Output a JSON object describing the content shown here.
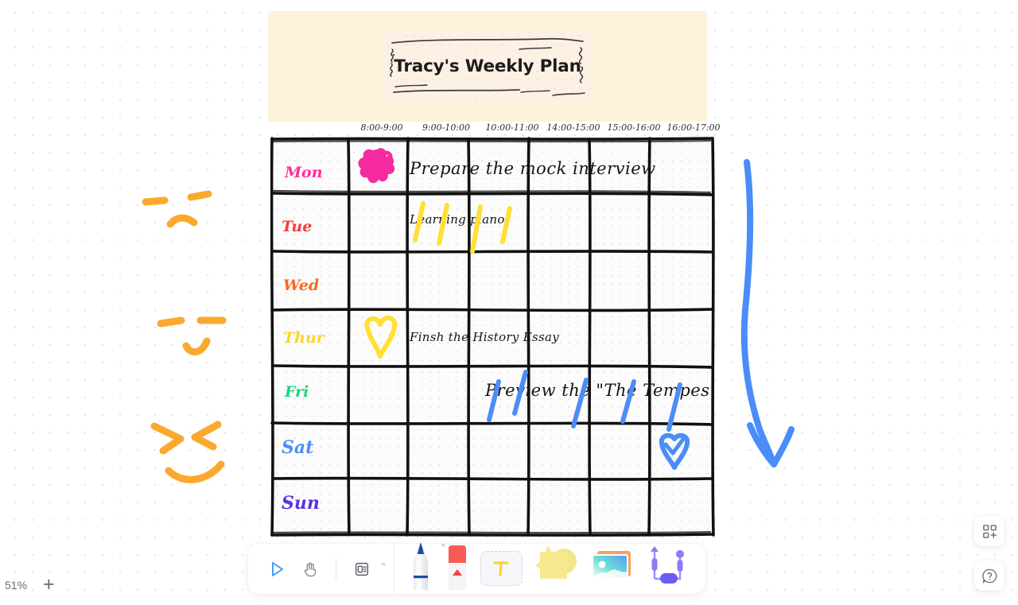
{
  "app": {
    "zoom_level": "51%",
    "zoom_in_label": "+"
  },
  "board": {
    "title": "Tracy's Weekly Plan",
    "time_slots": [
      "8:00-9:00",
      "9:00-10:00",
      "10:00-11:00",
      "14:00-15:00",
      "15:00-16:00",
      "16:00-17:00"
    ],
    "days": [
      {
        "label": "Mon",
        "color": "#ff2e9a"
      },
      {
        "label": "Tue",
        "color": "#f93a3a"
      },
      {
        "label": "Wed",
        "color": "#fa6a1e"
      },
      {
        "label": "Thur",
        "color": "#ffd429"
      },
      {
        "label": "Fri",
        "color": "#19d67f"
      },
      {
        "label": "Sat",
        "color": "#4f8dfb"
      },
      {
        "label": "Sun",
        "color": "#5b32e0"
      }
    ],
    "tasks": [
      {
        "day": "Mon",
        "text": "Prepare the mock interview"
      },
      {
        "day": "Tue",
        "text": "Learning piano"
      },
      {
        "day": "Thur",
        "text": "Finsh the History Essay"
      },
      {
        "day": "Fri",
        "text": "Preview the \"The Tempest"
      }
    ],
    "annotations": [
      {
        "name": "pink-flower-doodle",
        "color": "#f72ba0",
        "day": "Mon",
        "slot": "8:00-9:00"
      },
      {
        "name": "yellow-heart-doodle",
        "color": "#ffe033",
        "day": "Thur",
        "slot": "8:00-9:00"
      },
      {
        "name": "blue-check-heart-doodle",
        "color": "#4b8df8",
        "day": "Sat",
        "slot": "16:00-17:00"
      },
      {
        "name": "yellow-highlight-strokes",
        "color": "#ffe033",
        "day": "Tue"
      },
      {
        "name": "blue-highlight-strokes",
        "color": "#4b8df8",
        "day": "Fri"
      }
    ]
  },
  "canvas_doodles": [
    {
      "name": "orange-face-neutral",
      "color": "#fba92e"
    },
    {
      "name": "orange-face-smile",
      "color": "#fba92e"
    },
    {
      "name": "orange-face-grin",
      "color": "#fba92e"
    },
    {
      "name": "blue-down-arrow",
      "color": "#4b8df8"
    }
  ],
  "toolbar": {
    "left_tools": [
      {
        "name": "select-cursor-tool",
        "icon": "cursor-arrow-icon",
        "active": true
      },
      {
        "name": "hand-pan-tool",
        "icon": "hand-icon",
        "active": false
      },
      {
        "name": "template-tool",
        "icon": "template-icon",
        "active": false
      }
    ],
    "right_tools": [
      {
        "name": "pen-tool",
        "icon": "pen-icon",
        "color": "#1b4da8"
      },
      {
        "name": "eraser-tool",
        "icon": "eraser-icon",
        "color": "#fa5a54"
      },
      {
        "name": "text-tool",
        "icon": "text-t-icon",
        "color": "#ffd429"
      },
      {
        "name": "sticky-note-tool",
        "icon": "sticky-note-icon",
        "color": "#f7e98f"
      },
      {
        "name": "image-tool",
        "icon": "image-icon",
        "color": "#4fd8e0"
      },
      {
        "name": "shape-connector-tool",
        "icon": "connector-icon",
        "color": "#6a5cf5"
      }
    ]
  },
  "floating_buttons": [
    {
      "name": "apps-grid-button",
      "icon": "grid-plus-icon"
    },
    {
      "name": "help-button",
      "icon": "help-question-icon"
    }
  ]
}
